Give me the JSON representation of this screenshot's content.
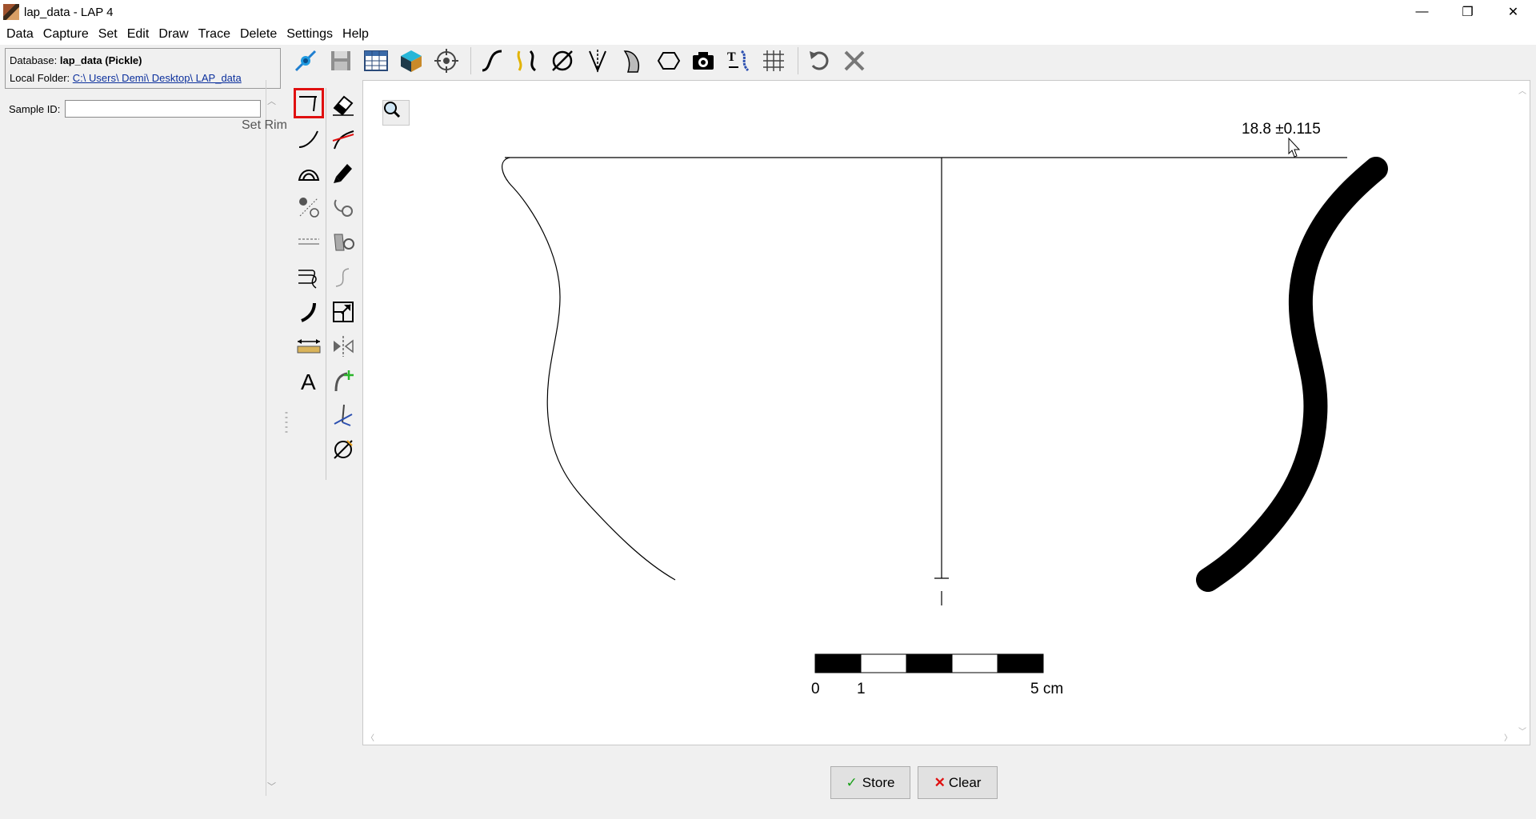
{
  "window": {
    "title": "lap_data - LAP 4",
    "minimize": "—",
    "maximize": "❐",
    "close": "✕"
  },
  "menu": [
    "Data",
    "Capture",
    "Set",
    "Edit",
    "Draw",
    "Trace",
    "Delete",
    "Settings",
    "Help"
  ],
  "info": {
    "database_label": "Database:",
    "database_value": "lap_data (Pickle)",
    "folder_label": "Local Folder:",
    "folder_value": "C:\\ Users\\ Demi\\ Desktop\\ LAP_data"
  },
  "sample": {
    "label": "Sample ID:",
    "value": ""
  },
  "tool_hint": "Set Rim",
  "canvas": {
    "measurement": "18.8 ±0.115",
    "scale_labels": [
      "0",
      "1",
      "5 cm"
    ]
  },
  "buttons": {
    "store": "Store",
    "clear": "Clear"
  },
  "colors": {
    "selected_tool_border": "#e01010",
    "store_check": "#19a019",
    "clear_x": "#e01010"
  }
}
